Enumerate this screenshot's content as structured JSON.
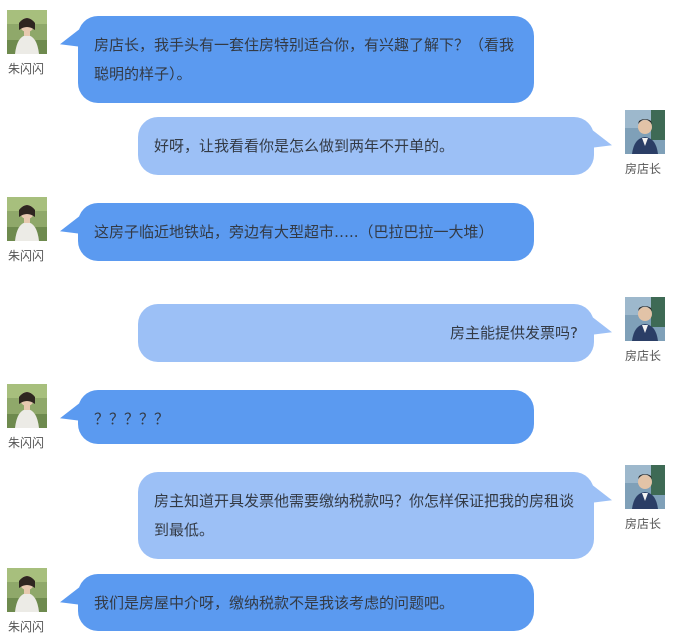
{
  "conversation": {
    "messages": [
      {
        "side": "left",
        "name": "朱闪闪",
        "text": "房店长，我手头有一套住房特别适合你，有兴趣了解下？（看我聪明的样子）。",
        "avatar_icon": "woman-avatar-icon"
      },
      {
        "side": "right",
        "name": "房店长",
        "text": "好呀，让我看看你是怎么做到两年不开单的。",
        "avatar_icon": "man-avatar-icon"
      },
      {
        "side": "left",
        "name": "朱闪闪",
        "text": "这房子临近地铁站，旁边有大型超市…..（巴拉巴拉一大堆）",
        "avatar_icon": "woman-avatar-icon"
      },
      {
        "side": "right",
        "name": "房店长",
        "text": "房主能提供发票吗?",
        "avatar_icon": "man-avatar-icon"
      },
      {
        "side": "left",
        "name": "朱闪闪",
        "text": "？？？？？",
        "avatar_icon": "woman-avatar-icon"
      },
      {
        "side": "right",
        "name": "房店长",
        "text": "房主知道开具发票他需要缴纳税款吗？你怎样保证把我的房租谈到最低。",
        "avatar_icon": "man-avatar-icon"
      },
      {
        "side": "left",
        "name": "朱闪闪",
        "text": "我们是房屋中介呀，缴纳税款不是我该考虑的问题吧。",
        "avatar_icon": "woman-avatar-icon"
      }
    ]
  },
  "colors": {
    "left_bubble": "#5b9af0",
    "right_bubble": "#9cc0f6",
    "text": "#333a45",
    "name_text": "#555555"
  }
}
